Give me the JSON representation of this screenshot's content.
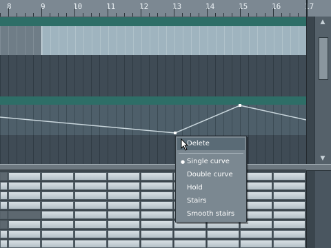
{
  "ruler": {
    "bars": [
      "8",
      "9",
      "10",
      "11",
      "12",
      "13",
      "14",
      "15",
      "16",
      "17"
    ]
  },
  "context_menu": {
    "items": [
      {
        "label": "Delete",
        "selected": false
      },
      {
        "label": "Single curve",
        "selected": true
      },
      {
        "label": "Double curve",
        "selected": false
      },
      {
        "label": "Hold",
        "selected": false
      },
      {
        "label": "Stairs",
        "selected": false
      },
      {
        "label": "Smooth stairs",
        "selected": false
      }
    ]
  },
  "colors": {
    "track_header": "#2e6e67",
    "clip": "#9fb4bf",
    "menu_bg": "#7b8891",
    "envelope_line": "#c9d6dc"
  },
  "icons": {
    "cursor": "arrow-cursor-icon",
    "bullet": "bullet-icon",
    "scroll_up": "arrow-up-icon",
    "scroll_down": "arrow-down-icon"
  }
}
